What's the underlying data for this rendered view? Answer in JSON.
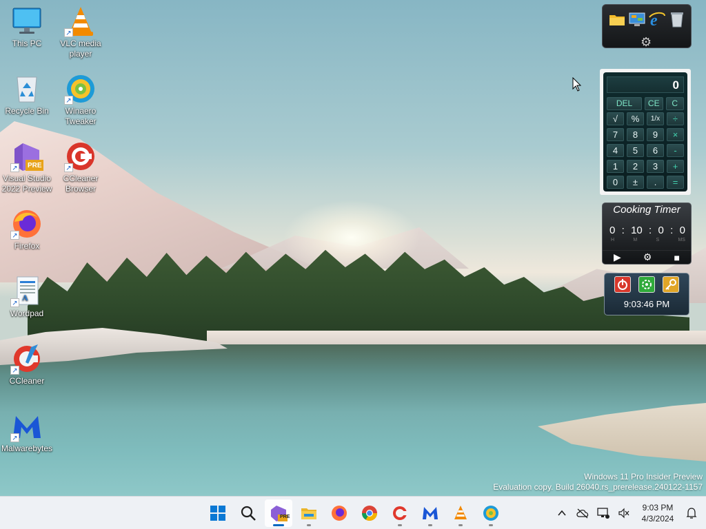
{
  "desktop": {
    "icons": [
      {
        "label": "This PC",
        "icon": "this-pc-icon"
      },
      {
        "label": "VLC media player",
        "icon": "vlc-icon"
      },
      {
        "label": "Recycle Bin",
        "icon": "recycle-bin-icon"
      },
      {
        "label": "Winaero Tweaker",
        "icon": "winaero-tweaker-icon"
      },
      {
        "label": "Visual Studio 2022 Preview",
        "icon": "visual-studio-icon"
      },
      {
        "label": "CCleaner Browser",
        "icon": "ccleaner-browser-icon"
      },
      {
        "label": "Firefox",
        "icon": "firefox-icon"
      },
      {
        "label": "Wordpad",
        "icon": "wordpad-icon"
      },
      {
        "label": "CCleaner",
        "icon": "ccleaner-icon"
      },
      {
        "label": "Malwarebytes",
        "icon": "malwarebytes-icon"
      }
    ],
    "vs_badge": "PRE"
  },
  "gadgets": {
    "launcher": {
      "items": [
        "folder-icon",
        "control-panel-icon",
        "internet-explorer-icon",
        "recycle-bin-icon"
      ],
      "settings_icon": "gear-icon"
    },
    "calculator": {
      "display": "0",
      "top_keys": [
        "DEL",
        "CE",
        "C"
      ],
      "keys": [
        "√",
        "%",
        "1/x",
        "÷",
        "7",
        "8",
        "9",
        "×",
        "4",
        "5",
        "6",
        "-",
        "1",
        "2",
        "3",
        "+",
        "0",
        "±",
        ".",
        "="
      ]
    },
    "cooking_timer": {
      "title": "Cooking Timer",
      "hours": "0",
      "minutes": "10",
      "seconds": "0",
      "ms": "0",
      "sep": ":",
      "units": [
        "H",
        "M",
        "S",
        "MS"
      ],
      "controls": [
        "play-icon",
        "gear-icon",
        "stop-icon"
      ]
    },
    "shutdown_clock": {
      "buttons": [
        "power-icon",
        "restart-icon",
        "lock-icon"
      ],
      "time": "9:03:46 PM"
    }
  },
  "watermark": {
    "line1": "Windows 11 Pro Insider Preview",
    "line2": "Evaluation copy. Build 26040.rs_prerelease.240122-1157"
  },
  "taskbar": {
    "apps": [
      {
        "name": "start-button",
        "icon": "windows-logo-icon"
      },
      {
        "name": "search-button",
        "icon": "search-icon"
      },
      {
        "name": "visual-studio-preview",
        "icon": "visual-studio-icon",
        "badge": "PRE",
        "active": true
      },
      {
        "name": "file-explorer",
        "icon": "folder-icon"
      },
      {
        "name": "firefox",
        "icon": "firefox-icon"
      },
      {
        "name": "chrome",
        "icon": "chrome-icon"
      },
      {
        "name": "ccleaner",
        "icon": "ccleaner-icon"
      },
      {
        "name": "malwarebytes",
        "icon": "malwarebytes-icon"
      },
      {
        "name": "vlc",
        "icon": "vlc-icon"
      },
      {
        "name": "winaero-tweaker",
        "icon": "winaero-tweaker-icon"
      }
    ],
    "tray": {
      "icons": [
        "chevron-up-icon",
        "cloud-offline-icon",
        "network-icon",
        "volume-muted-icon"
      ],
      "time": "9:03 PM",
      "date": "4/3/2024",
      "notification_icon": "bell-icon"
    }
  },
  "colors": {
    "taskbar_bg": "#eef1f5",
    "accent": "#0067c0",
    "calc_key_op": "#43d3b0"
  }
}
